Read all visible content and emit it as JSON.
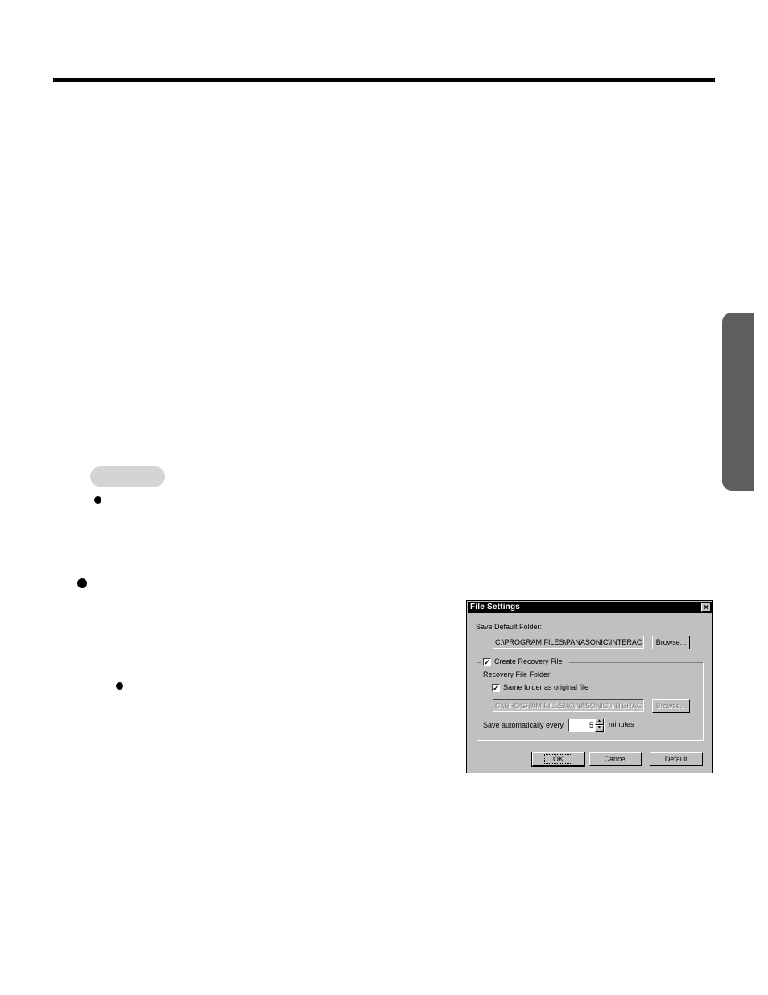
{
  "dialog": {
    "title": "File Settings",
    "close_glyph": "×",
    "save_default_folder_label": "Save Default Folder:",
    "save_default_folder_value": "C:\\PROGRAM FILES\\PANASONIC\\INTERAC",
    "browse_label": "Browse...",
    "create_recovery_label": "Create Recovery File",
    "create_recovery_checked": "✓",
    "recovery_folder_label": "Recovery File Folder:",
    "same_folder_label": "Same folder as original file",
    "same_folder_checked": "✓",
    "recovery_folder_value": "C:\\PROGRAM FILES\\PANASONIC\\INTERAC",
    "recovery_browse_label": "Browse...",
    "autosave_label": "Save automatically every",
    "autosave_value": "5",
    "minutes_label": "minutes",
    "ok_label": "OK",
    "cancel_label": "Cancel",
    "default_label": "Default"
  }
}
